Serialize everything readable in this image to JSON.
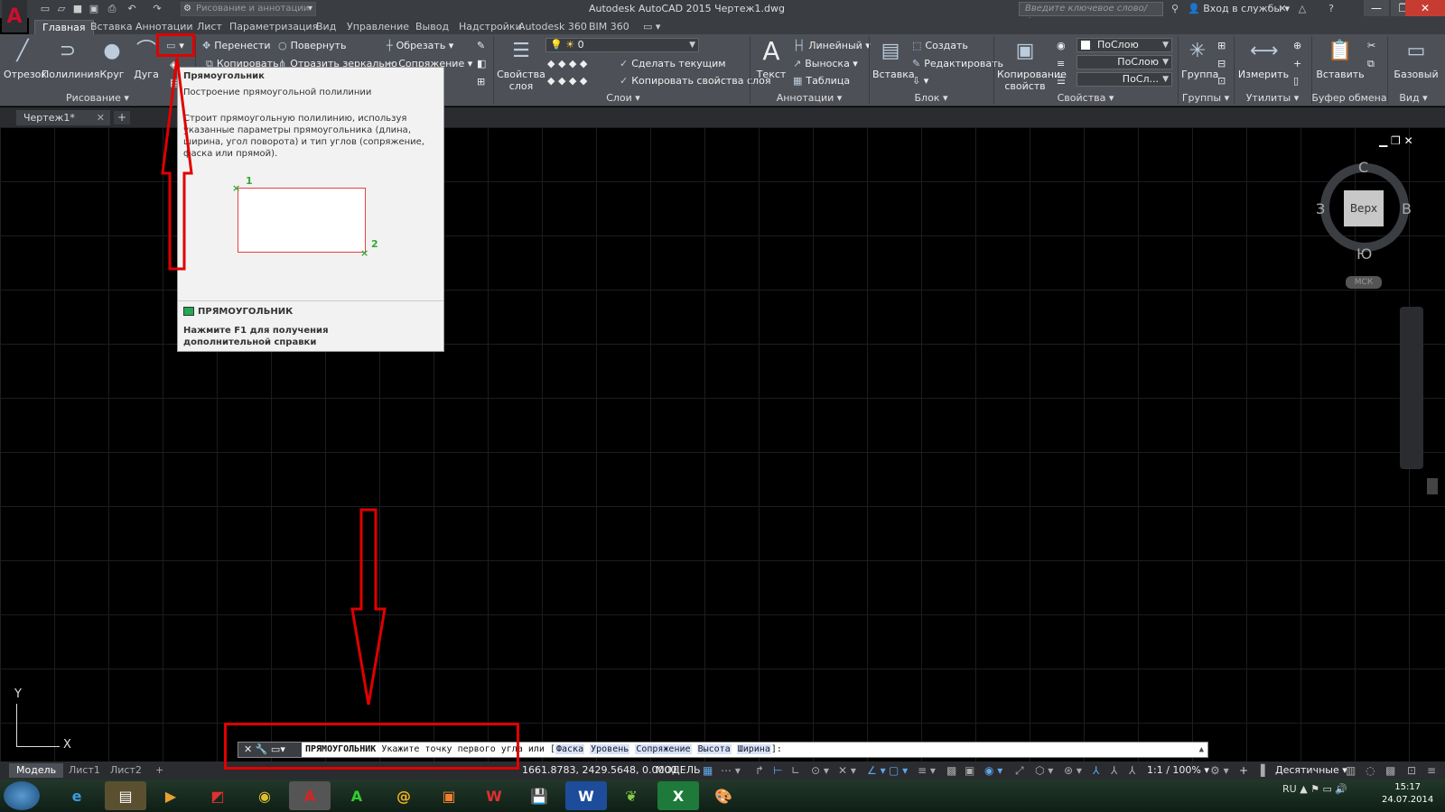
{
  "app": {
    "title": "Autodesk AutoCAD 2015    Чертеж1.dwg",
    "logo": "A"
  },
  "qat": {
    "workspace": "Рисование и аннотации"
  },
  "search": {
    "placeholder": "Введите ключевое слово/фразу"
  },
  "login": "Вход в службы",
  "ribbon_tabs": [
    "Главная",
    "Вставка",
    "Аннотации",
    "Лист",
    "Параметризация",
    "Вид",
    "Управление",
    "Вывод",
    "Надстройки",
    "Autodesk 360",
    "BIM 360"
  ],
  "draw_panel": {
    "title": "Рисование",
    "line": "Отрезок",
    "polyline": "Полилиния",
    "circle": "Круг",
    "arc": "Дуга"
  },
  "modify_panel": {
    "move": "Перенести",
    "rotate": "Повернуть",
    "trim": "Обрезать",
    "copy": "Копировать",
    "mirror": "Отразить зеркально",
    "fillet": "Сопряжение"
  },
  "layers_panel": {
    "title": "Слои",
    "properties_label": "Свойства\nслоя",
    "current_layer": "0",
    "make_current": "Сделать текущим",
    "match_layer": "Копировать свойства слоя"
  },
  "annotations_panel": {
    "title": "Аннотации",
    "text": "Текст",
    "linear": "Линейный",
    "leader": "Выноска",
    "table": "Таблица"
  },
  "block_panel": {
    "title": "Блок",
    "insert": "Вставка",
    "create": "Создать",
    "edit": "Редактировать"
  },
  "properties_panel": {
    "title": "Свойства",
    "match": "Копирование\nсвойств",
    "color": "ПоСлою",
    "linetype": "ПоСлою",
    "lineweight": "ПоСл..."
  },
  "groups_panel": {
    "title": "Группы",
    "group": "Группа"
  },
  "utilities_panel": {
    "title": "Утилиты",
    "measure": "Измерить"
  },
  "clipboard_panel": {
    "title": "Буфер обмена",
    "paste": "Вставить"
  },
  "view_panel": {
    "title": "Вид",
    "base": "Базовый"
  },
  "file_tab": "Чертеж1*",
  "tooltip": {
    "title": "Прямоугольник",
    "subtitle": "Построение прямоугольной полилинии",
    "description": "Строит прямоугольную полилинию, используя указанные параметры прямоугольника (длина, ширина, угол поворота) и тип углов (сопряжение, фаска или прямой).",
    "point1": "1",
    "point2": "2",
    "command": "ПРЯМОУГОЛЬНИК",
    "help": "Нажмите F1 для получения дополнительной справки"
  },
  "viewcube": {
    "top": "Верх",
    "north": "С",
    "south": "Ю",
    "west": "З",
    "east": "В",
    "wcs": "МСК"
  },
  "ucs": {
    "x": "X",
    "y": "Y"
  },
  "command_line": {
    "command": "ПРЯМОУГОЛЬНИК",
    "prompt": "Укажите точку первого угла или",
    "options": [
      "Фаска",
      "Уровень",
      "Сопряжение",
      "Высота",
      "Ширина"
    ],
    "suffix": "]:"
  },
  "layout_tabs": [
    "Модель",
    "Лист1",
    "Лист2"
  ],
  "status": {
    "coords": "1661.8783, 2429.5648, 0.0000",
    "space": "МОДЕЛЬ",
    "scale": "1:1 / 100%",
    "units": "Десятичные"
  },
  "tray": {
    "lang": "RU",
    "time": "15:17",
    "date": "24.07.2014"
  },
  "colors": {
    "highlight_red": "#e00000",
    "ribbon_bg": "#4d5157",
    "canvas_bg": "#000000"
  }
}
